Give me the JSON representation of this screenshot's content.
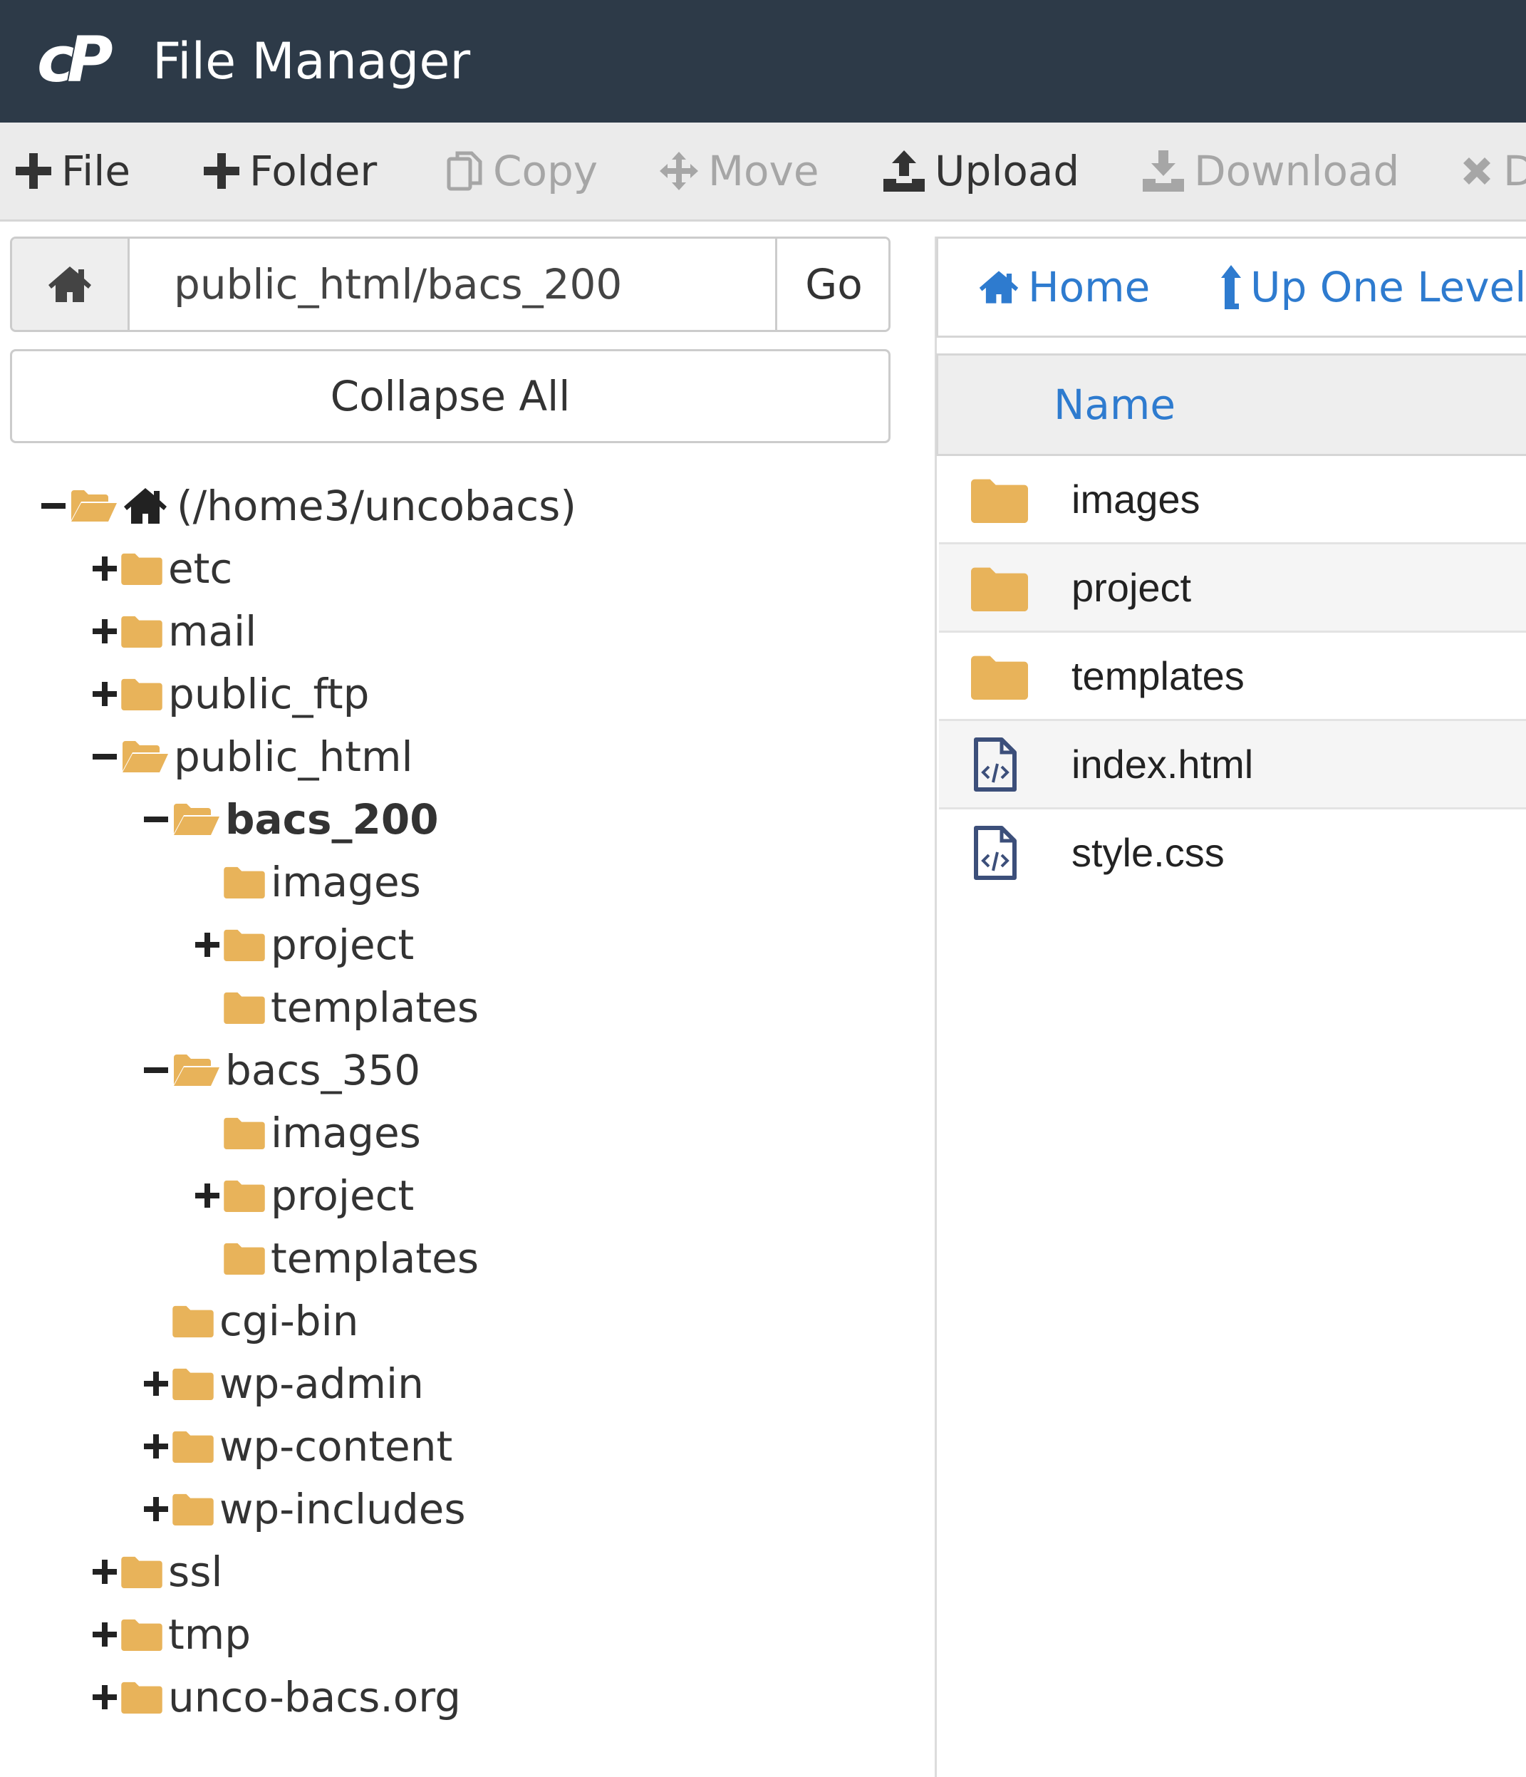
{
  "app": {
    "title": "File Manager"
  },
  "toolbar": {
    "file_label": "File",
    "folder_label": "Folder",
    "copy_label": "Copy",
    "move_label": "Move",
    "upload_label": "Upload",
    "download_label": "Download",
    "delete_label": "D"
  },
  "path_bar": {
    "value": "public_html/bacs_200",
    "go_label": "Go"
  },
  "collapse_label": "Collapse All",
  "tree": [
    {
      "label": "(/home3/uncobacs)",
      "toggle": "minus",
      "open": true,
      "home": true
    },
    {
      "label": "etc",
      "toggle": "plus",
      "open": false
    },
    {
      "label": "mail",
      "toggle": "plus",
      "open": false
    },
    {
      "label": "public_ftp",
      "toggle": "plus",
      "open": false
    },
    {
      "label": "public_html",
      "toggle": "minus",
      "open": true
    },
    {
      "label": "bacs_200",
      "toggle": "minus",
      "open": true,
      "selected": true
    },
    {
      "label": "images",
      "toggle": "none",
      "open": false
    },
    {
      "label": "project",
      "toggle": "plus",
      "open": false
    },
    {
      "label": "templates",
      "toggle": "none",
      "open": false
    },
    {
      "label": "bacs_350",
      "toggle": "minus",
      "open": true
    },
    {
      "label": "images",
      "toggle": "none",
      "open": false
    },
    {
      "label": "project",
      "toggle": "plus",
      "open": false
    },
    {
      "label": "templates",
      "toggle": "none",
      "open": false
    },
    {
      "label": "cgi-bin",
      "toggle": "none",
      "open": false
    },
    {
      "label": "wp-admin",
      "toggle": "plus",
      "open": false
    },
    {
      "label": "wp-content",
      "toggle": "plus",
      "open": false
    },
    {
      "label": "wp-includes",
      "toggle": "plus",
      "open": false
    },
    {
      "label": "ssl",
      "toggle": "plus",
      "open": false
    },
    {
      "label": "tmp",
      "toggle": "plus",
      "open": false
    },
    {
      "label": "unco-bacs.org",
      "toggle": "plus",
      "open": false
    }
  ],
  "nav": {
    "home_label": "Home",
    "up_label": "Up One Level"
  },
  "list": {
    "name_header": "Name",
    "rows": [
      {
        "name": "images",
        "type": "folder"
      },
      {
        "name": "project",
        "type": "folder"
      },
      {
        "name": "templates",
        "type": "folder"
      },
      {
        "name": "index.html",
        "type": "code-file"
      },
      {
        "name": "style.css",
        "type": "code-file"
      }
    ]
  },
  "colors": {
    "header_bg": "#2d3a48",
    "folder": "#e8b35a",
    "link": "#2e7bcf",
    "disabled": "#a6a6a6"
  }
}
